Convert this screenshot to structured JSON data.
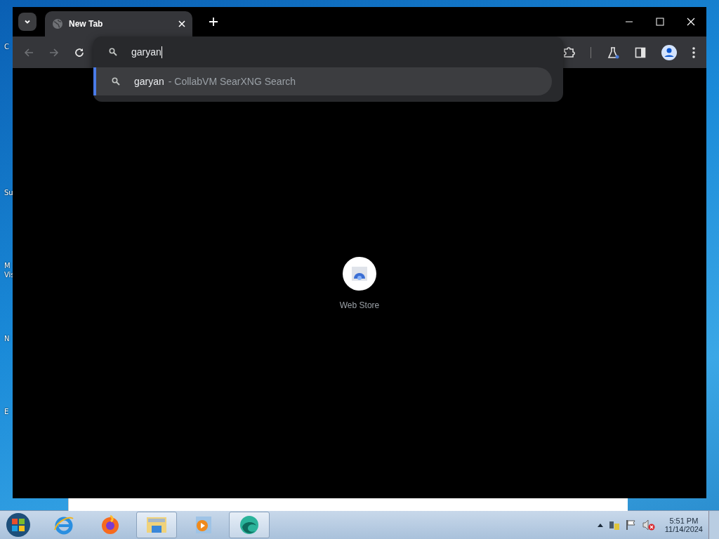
{
  "desktop_icons": [
    {
      "label": "C"
    },
    {
      "label": "Su"
    },
    {
      "label": "M Vis"
    },
    {
      "label": "N"
    },
    {
      "label": "E"
    }
  ],
  "browser": {
    "tabs": [
      {
        "title": "New Tab",
        "selected": true
      }
    ],
    "omnibox": {
      "value": "garyan",
      "suggestions": [
        {
          "query": "garyan",
          "description": "- CollabVM SearXNG Search",
          "selected": true
        }
      ]
    },
    "shortcuts": [
      {
        "label": "Web Store"
      }
    ]
  },
  "taskbar": {
    "apps": [
      {
        "kind": "ie",
        "selected": false
      },
      {
        "kind": "firefox",
        "selected": false
      },
      {
        "kind": "folder",
        "selected": true
      },
      {
        "kind": "media",
        "selected": false
      },
      {
        "kind": "edge",
        "selected": true
      }
    ],
    "clock": {
      "time": "5:51 PM",
      "date": "11/14/2024"
    }
  }
}
